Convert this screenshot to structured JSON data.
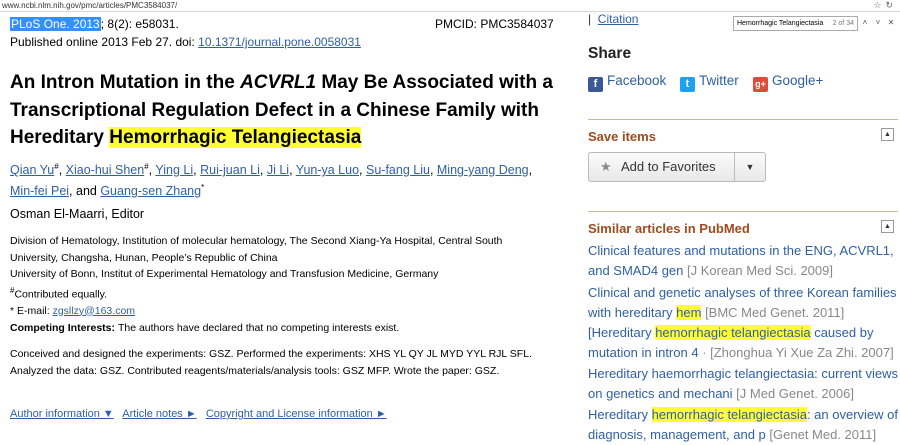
{
  "browser": {
    "url": "www.ncbi.nlm.nih.gov/pmc/articles/PMC3584037/",
    "find": {
      "query": "Hemorrhagic Telangiectasia",
      "count": "2 of 34",
      "up_icon": "chevron-up-icon",
      "down_icon": "chevron-down-icon",
      "close_icon": "close-icon"
    }
  },
  "article": {
    "journal": "PLoS One. 2013",
    "citation_rest": "; 8(2): e58031.",
    "pmcid": "PMCID: PMC3584037",
    "published": "Published online 2013 Feb 27. doi: ",
    "doi": "10.1371/journal.pone.0058031",
    "title_part1": "An Intron Mutation in the ",
    "title_gene": "ACVRL1",
    "title_part2": " May Be Associated with a Transcriptional Regulation Defect in a Chinese Family with Hereditary ",
    "title_highlight": "Hemorrhagic Telangiectasia",
    "authors": [
      {
        "name": "Qian Yu",
        "sup": "#",
        "sep": ", "
      },
      {
        "name": "Xiao-hui Shen",
        "sup": "#",
        "sep": ", "
      },
      {
        "name": "Ying Li",
        "sup": "",
        "sep": ", "
      },
      {
        "name": "Rui-juan Li",
        "sup": "",
        "sep": ", "
      },
      {
        "name": "Ji Li",
        "sup": "",
        "sep": ", "
      },
      {
        "name": "Yun-ya Luo",
        "sup": "",
        "sep": ", "
      },
      {
        "name": "Su-fang Liu",
        "sup": "",
        "sep": ", "
      },
      {
        "name": "Ming-yang Deng",
        "sup": "",
        "sep": ", "
      },
      {
        "name": "Min-fei Pei",
        "sup": "",
        "sep": ", and "
      },
      {
        "name": "Guang-sen Zhang",
        "sup": "*",
        "sep": ""
      }
    ],
    "editor": "Osman El-Maarri, Editor",
    "affiliation1": "Division of Hematology, Institution of molecular hematology, The Second Xiang-Ya Hospital, Central South University, Changsha, Hunan, People’s Republic of China",
    "affiliation2": "University of Bonn, Institut of Experimental Hematology and Transfusion Medicine, Germany",
    "contrib_mark": "#",
    "contrib_text": "Contributed equally.",
    "email_label": "* E-mail: ",
    "email": "zgsllzy@163.com",
    "competing_label": "Competing Interests: ",
    "competing_text": "The authors have declared that no competing interests exist.",
    "contributions": "Conceived and designed the experiments: GSZ. Performed the experiments: XHS YL QY JL MYD YYL RJL SFL. Analyzed the data: GSZ. Contributed reagents/materials/analysis tools: GSZ MFP. Wrote the paper: GSZ.",
    "links": [
      "Author information ▼",
      "Article notes ►",
      "Copyright and License information ►"
    ]
  },
  "sidebar": {
    "citation": "Citation",
    "share_heading": "Share",
    "share": [
      {
        "label": "Facebook",
        "icon": "facebook-icon",
        "glyph": "f",
        "color": "#3b5998"
      },
      {
        "label": "Twitter",
        "icon": "twitter-icon",
        "glyph": "t",
        "color": "#1da1f2"
      },
      {
        "label": "Google+",
        "icon": "google-plus-icon",
        "glyph": "g+",
        "color": "#dd4b39"
      }
    ],
    "save_heading": "Save items",
    "favorites_label": "Add to Favorites",
    "similar_heading": "Similar articles in PubMed",
    "similar": [
      {
        "pre": "Clinical features and mutations in the ENG, ACVRL1, and SMAD4 gen",
        "hl": "",
        "post": "",
        "src": " [J Korean Med Sci. 2009]"
      },
      {
        "pre": "Clinical and genetic analyses of three Korean families with hereditary ",
        "hl": "hem",
        "post": "",
        "src": " [BMC Med Genet. 2011]"
      },
      {
        "pre": "[Hereditary ",
        "hl": "hemorrhagic telangiectasia",
        "post": " caused by mutation in intron 4",
        "src": " · [Zhonghua Yi Xue Za Zhi. 2007]"
      },
      {
        "pre": "Hereditary haemorrhagic telangiectasia: current views on genetics and mechani",
        "hl": "",
        "post": "",
        "src": " [J Med Genet. 2006]"
      },
      {
        "pre": "Hereditary ",
        "hl": "hemorrhagic telangiectasia",
        "post": ": an overview of diagnosis, management, and p",
        "src": " [Genet Med. 2011]"
      }
    ]
  }
}
